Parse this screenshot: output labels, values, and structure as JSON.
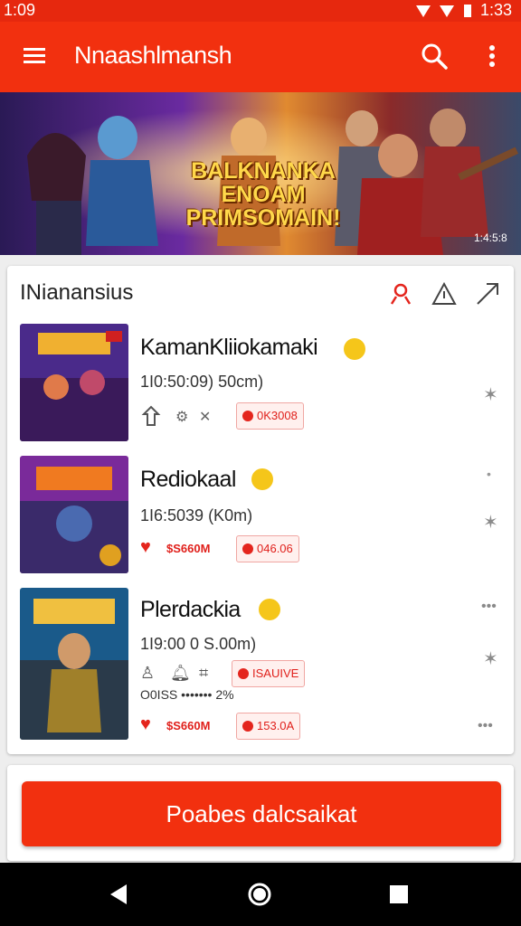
{
  "status": {
    "time_left": "1:09",
    "time_right": "1:33"
  },
  "appbar": {
    "title": "Nnaashlmansh"
  },
  "banner": {
    "text_line1": "BALKNANKA",
    "text_line2": "ENOAM",
    "text_line3": "PRIMSOMAIN!",
    "corner": "1:4:5:8"
  },
  "section": {
    "title": "INianansius"
  },
  "items": [
    {
      "title": "KamanKliiokamaki",
      "sub": "1I0:50:09) 50cm)",
      "tag": "0K3008",
      "like_price": ""
    },
    {
      "title": "Rediokaal",
      "sub": "1I6:5039  (K0m)",
      "tag": "046.06",
      "like_price": "$S660M"
    },
    {
      "title": "Plerdackia",
      "sub": "1I9:00  0 S.00m)",
      "tag": "ISAUIVE",
      "like_price": "$S660M",
      "extra": "O0ISS",
      "extra_right": "2%",
      "tag2": "153.0A"
    }
  ],
  "cta": {
    "label": "Poabes dalcsaikat"
  },
  "colors": {
    "primary": "#f2300f",
    "accent": "#e4251d",
    "smiley": "#f5c61a"
  }
}
